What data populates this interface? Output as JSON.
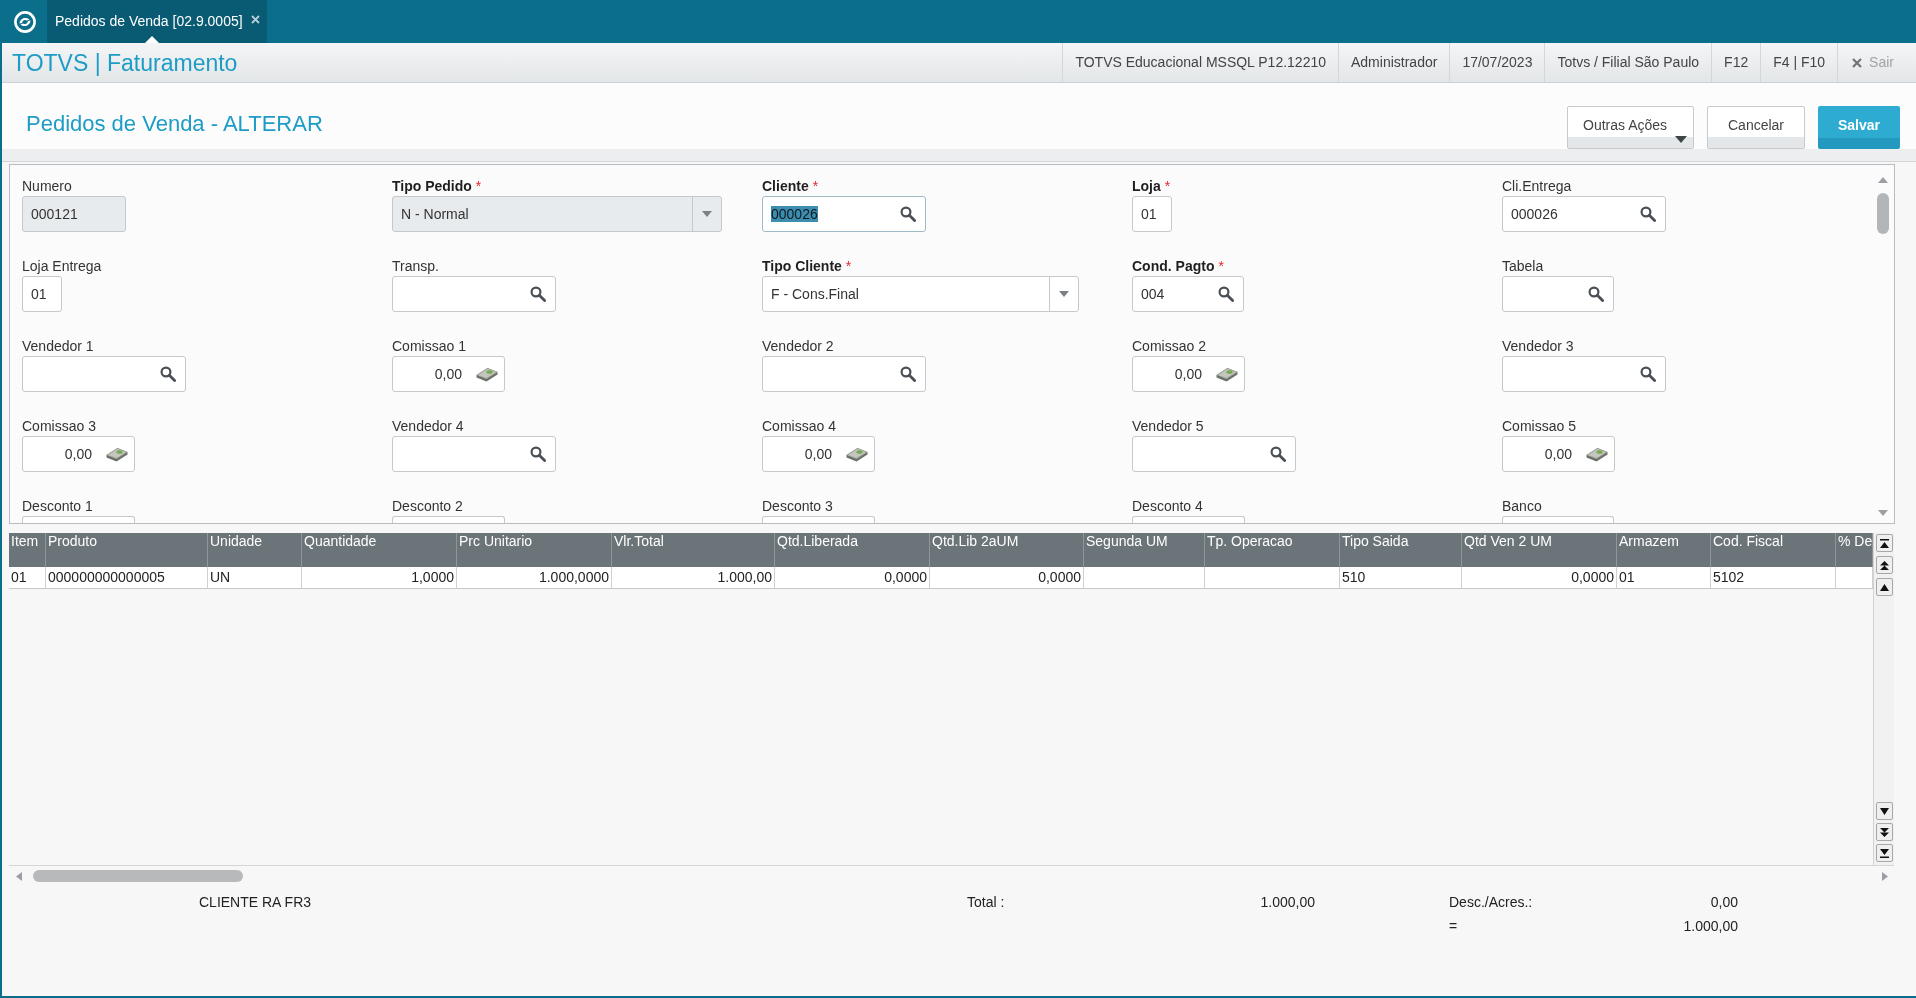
{
  "top_bar": {
    "tabs": [
      {
        "label": "Pedidos de Venda [02.9.0005]",
        "selected": true
      }
    ]
  },
  "header": {
    "title": "TOTVS | Faturamento",
    "items": [
      "TOTVS Educacional MSSQL P12.12210",
      "Administrador",
      "17/07/2023",
      "Totvs / Filial São Paulo",
      "F12",
      "F4 | F10"
    ],
    "exit_label": "Sair"
  },
  "page": {
    "title": "Pedidos de Venda - ALTERAR",
    "buttons": [
      {
        "label": "Outras Ações",
        "kind": "menu"
      },
      {
        "label": "Cancelar",
        "kind": "secondary"
      },
      {
        "label": "Salvar",
        "kind": "primary"
      }
    ]
  },
  "form": {
    "fields": [
      {
        "label": "Numero",
        "required": false,
        "kind": "text",
        "value": "000121",
        "disabled": true,
        "highlighted": false
      },
      {
        "label": "Tipo Pedido",
        "required": true,
        "mark": "*",
        "kind": "select",
        "value": "N - Normal",
        "disabled": true,
        "highlighted": false
      },
      {
        "label": "Cliente",
        "required": true,
        "mark": "*",
        "kind": "lookup",
        "value": "000026",
        "disabled": false,
        "highlighted": true
      },
      {
        "label": "Loja",
        "required": true,
        "mark": "*",
        "kind": "text",
        "value": "01",
        "disabled": false,
        "highlighted": false
      },
      {
        "label": "Cli.Entrega",
        "required": false,
        "kind": "lookup",
        "value": "000026",
        "disabled": false,
        "highlighted": false
      },
      {
        "label": "Loja Entrega",
        "required": false,
        "kind": "text",
        "value": "01",
        "disabled": false,
        "highlighted": false
      },
      {
        "label": "Transp.",
        "required": false,
        "kind": "lookup",
        "disabled": false,
        "highlighted": false
      },
      {
        "label": "Tipo Cliente",
        "required": true,
        "mark": "*",
        "kind": "select",
        "value": "F - Cons.Final",
        "disabled": false,
        "highlighted": false
      },
      {
        "label": "Cond. Pagto",
        "required": true,
        "mark": "*",
        "kind": "lookup",
        "value": "004",
        "disabled": false,
        "highlighted": false
      },
      {
        "label": "Tabela",
        "required": false,
        "kind": "lookup",
        "disabled": false,
        "highlighted": false
      },
      {
        "label": "Vendedor 1",
        "required": false,
        "kind": "lookup",
        "disabled": false,
        "highlighted": false
      },
      {
        "label": "Comissao 1",
        "required": false,
        "kind": "currency",
        "value": "0,00",
        "disabled": false,
        "highlighted": false
      },
      {
        "label": "Vendedor 2",
        "required": false,
        "kind": "lookup",
        "disabled": false,
        "highlighted": false
      },
      {
        "label": "Comissao 2",
        "required": false,
        "kind": "currency",
        "value": "0,00",
        "disabled": false,
        "highlighted": false
      },
      {
        "label": "Vendedor 3",
        "required": false,
        "kind": "lookup",
        "disabled": false,
        "highlighted": false
      },
      {
        "label": "Comissao 3",
        "required": false,
        "kind": "currency",
        "value": "0,00",
        "disabled": false,
        "highlighted": false
      },
      {
        "label": "Vendedor 4",
        "required": false,
        "kind": "lookup",
        "disabled": false,
        "highlighted": false
      },
      {
        "label": "Comissao 4",
        "required": false,
        "kind": "currency",
        "value": "0,00",
        "disabled": false,
        "highlighted": false
      },
      {
        "label": "Vendedor 5",
        "required": false,
        "kind": "lookup",
        "disabled": false,
        "highlighted": false
      },
      {
        "label": "Comissao 5",
        "required": false,
        "kind": "currency",
        "value": "0,00",
        "disabled": false,
        "highlighted": false
      },
      {
        "label": "Desconto 1",
        "required": false,
        "kind": "text",
        "disabled": false,
        "highlighted": false
      },
      {
        "label": "Desconto 2",
        "required": false,
        "kind": "text",
        "disabled": false,
        "highlighted": false
      },
      {
        "label": "Desconto 3",
        "required": false,
        "kind": "text",
        "disabled": false,
        "highlighted": false
      },
      {
        "label": "Desconto 4",
        "required": false,
        "kind": "text",
        "disabled": false,
        "highlighted": false
      },
      {
        "label": "Banco",
        "required": false,
        "kind": "text",
        "disabled": false,
        "highlighted": false
      }
    ]
  },
  "grid": {
    "columns": [
      {
        "label": "Item",
        "kind": "text"
      },
      {
        "label": "Produto",
        "kind": "text"
      },
      {
        "label": "Unidade",
        "kind": "text"
      },
      {
        "label": "Quantidade",
        "kind": "number"
      },
      {
        "label": "Prc Unitario",
        "kind": "number"
      },
      {
        "label": "Vlr.Total",
        "kind": "number"
      },
      {
        "label": "Qtd.Liberada",
        "kind": "number"
      },
      {
        "label": "Qtd.Lib 2aUM",
        "kind": "number"
      },
      {
        "label": "Segunda UM",
        "kind": "text"
      },
      {
        "label": "Tp. Operacao",
        "kind": "text"
      },
      {
        "label": "Tipo Saida",
        "kind": "text"
      },
      {
        "label": "Qtd Ven 2 UM",
        "kind": "number"
      },
      {
        "label": "Armazem",
        "kind": "text"
      },
      {
        "label": "Cod. Fiscal",
        "kind": "text"
      },
      {
        "label": "% De",
        "kind": "text"
      }
    ],
    "rows": [
      {
        "cells": [
          "01",
          "000000000000005",
          "UN",
          "1,0000",
          "1.000,0000",
          "1.000,00",
          "0,0000",
          "0,0000",
          null,
          null,
          "510",
          "0,0000",
          "01",
          "5102",
          null
        ]
      }
    ]
  },
  "footer": {
    "customer": "CLIENTE RA FR3",
    "total_label": "Total :",
    "total": "1.000,00",
    "discount_label": "Desc./Acres.:",
    "discount": "0,00",
    "net_label": "=",
    "net": "1.000,00"
  }
}
